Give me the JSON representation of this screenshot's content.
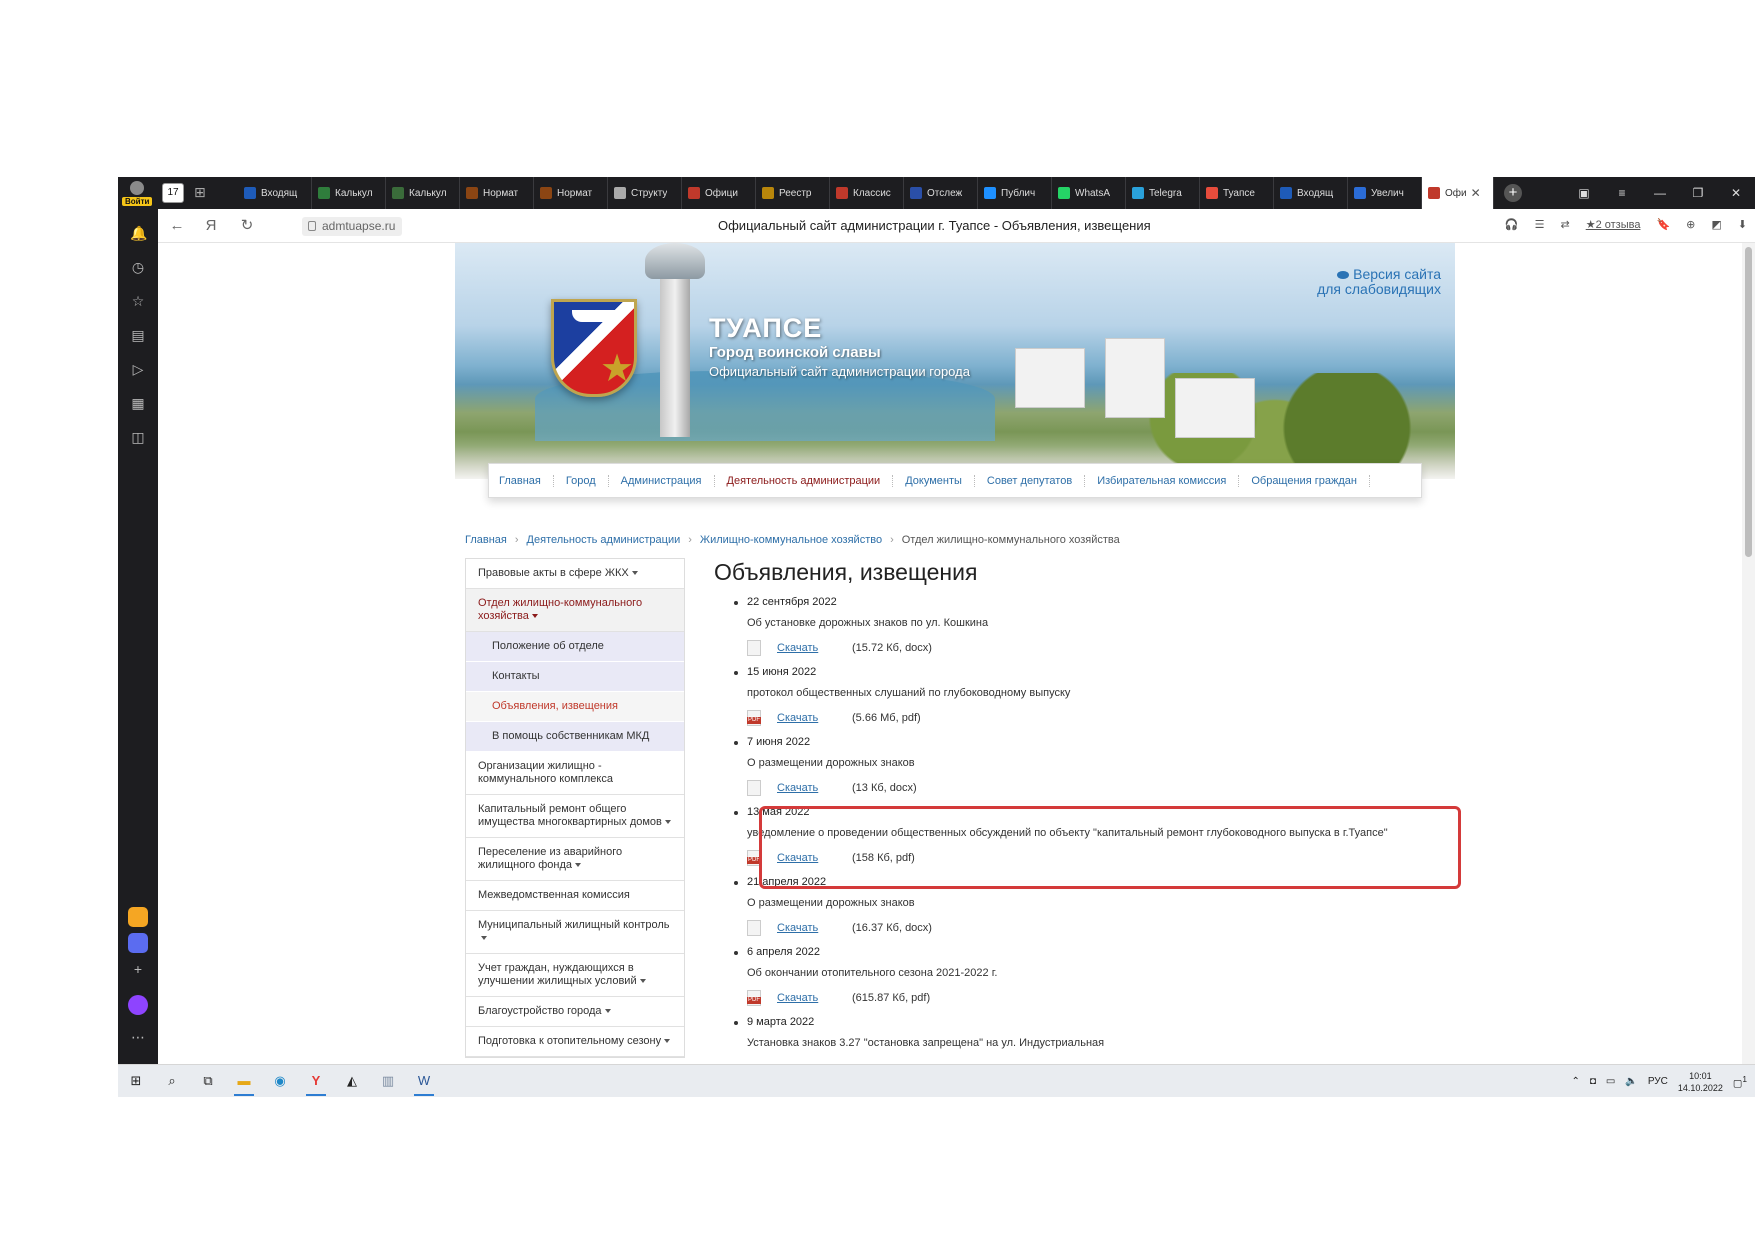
{
  "browser": {
    "login_label": "Войти",
    "tab_count_label": "17",
    "tabs": [
      {
        "label": "Входящ",
        "color": "#1e5bb8"
      },
      {
        "label": "Калькул",
        "color": "#2f7d3c"
      },
      {
        "label": "Калькул",
        "color": "#3a6b3a"
      },
      {
        "label": "Нормат",
        "color": "#8b4513"
      },
      {
        "label": "Нормат",
        "color": "#8b4513"
      },
      {
        "label": "Структу",
        "color": "#aaaaaa"
      },
      {
        "label": "Офици",
        "color": "#c0392b"
      },
      {
        "label": "Реестр",
        "color": "#b8860b"
      },
      {
        "label": "Классис",
        "color": "#c0392b"
      },
      {
        "label": "Отслеж",
        "color": "#2a4fa8"
      },
      {
        "label": "Публич",
        "color": "#1e90ff"
      },
      {
        "label": "WhatsA",
        "color": "#25d366"
      },
      {
        "label": "Telegra",
        "color": "#2aa1da"
      },
      {
        "label": "Туапсе",
        "color": "#e74c3c"
      },
      {
        "label": "Входящ",
        "color": "#1e5bb8"
      },
      {
        "label": "Увелич",
        "color": "#2b6cd6"
      }
    ],
    "active_tab": {
      "label": "Офи",
      "color": "#c0392b"
    },
    "url": "admtuapse.ru",
    "page_title": "Официальный сайт администрации г. Туапсе - Объявления, извещения",
    "reviews_label": "★2 отзыва"
  },
  "banner": {
    "title": "ТУАПСЕ",
    "subtitle": "Город воинской славы",
    "tagline": "Официальный сайт администрации города",
    "vision_line1": "Версия сайта",
    "vision_line2": "для слабовидящих"
  },
  "nav": {
    "items": [
      "Главная",
      "Город",
      "Администрация",
      "Деятельность администрации",
      "Документы",
      "Совет депутатов",
      "Избирательная комиссия",
      "Обращения граждан"
    ],
    "current_index": 3
  },
  "breadcrumb": [
    "Главная",
    "Деятельность администрации",
    "Жилищно-коммунальное хозяйство",
    "Отдел жилищно-коммунального хозяйства"
  ],
  "left_menu": {
    "items": [
      {
        "label": "Правовые акты в сфере ЖКХ",
        "caret": true
      },
      {
        "label": "Отдел жилищно-коммунального хозяйства",
        "caret": true,
        "open": true
      },
      {
        "label": "Положение об отделе",
        "sub": true
      },
      {
        "label": "Контакты",
        "sub": true
      },
      {
        "label": "Объявления, извещения",
        "sub": true,
        "current": true
      },
      {
        "label": "В помощь собственникам МКД",
        "sub": true
      },
      {
        "label": "Организации жилищно - коммунального комплекса"
      },
      {
        "label": "Капитальный ремонт общего имущества многоквартирных домов",
        "caret": true
      },
      {
        "label": "Переселение из аварийного жилищного фонда",
        "caret": true
      },
      {
        "label": "Межведомственная комиссия"
      },
      {
        "label": "Муниципальный жилищный контроль",
        "caret": true
      },
      {
        "label": "Учет граждан, нуждающихся в улучшении жилищных условий",
        "caret": true
      },
      {
        "label": "Благоустройство города",
        "caret": true
      },
      {
        "label": "Подготовка к отопительному сезону",
        "caret": true
      }
    ]
  },
  "content": {
    "heading": "Объявления, извещения",
    "download_label": "Скачать",
    "announcements": [
      {
        "date": "22 сентября 2022",
        "text": "Об установке дорожных знаков по ул. Кошкина",
        "size": "(15.72 Кб, docx)",
        "type": "doc"
      },
      {
        "date": "15 июня 2022",
        "text": "протокол общественных слушаний по глубоководному выпуску",
        "size": "(5.66 Мб, pdf)",
        "type": "pdf"
      },
      {
        "date": "7 июня 2022",
        "text": "О размещении дорожных знаков",
        "size": "(13 Кб, docx)",
        "type": "doc"
      },
      {
        "date": "13 мая 2022",
        "text": "уведомление о проведении общественных обсуждений по объекту \"капитальный ремонт глубоководного выпуска в г.Туапсе\"",
        "size": "(158 Кб, pdf)",
        "type": "pdf"
      },
      {
        "date": "21 апреля 2022",
        "text": "О размещении дорожных знаков",
        "size": "(16.37 Кб, docx)",
        "type": "doc"
      },
      {
        "date": "6 апреля 2022",
        "text": "Об окончании отопительного сезона 2021-2022 г.",
        "size": "(615.87 Кб, pdf)",
        "type": "pdf"
      },
      {
        "date": "9 марта 2022",
        "text": "Установка знаков 3.27 \"остановка запрещена\" на ул. Индустриальная",
        "size": "",
        "type": "doc"
      }
    ]
  },
  "taskbar": {
    "lang": "РУС",
    "time": "10:01",
    "date": "14.10.2022",
    "notifications": "1"
  }
}
